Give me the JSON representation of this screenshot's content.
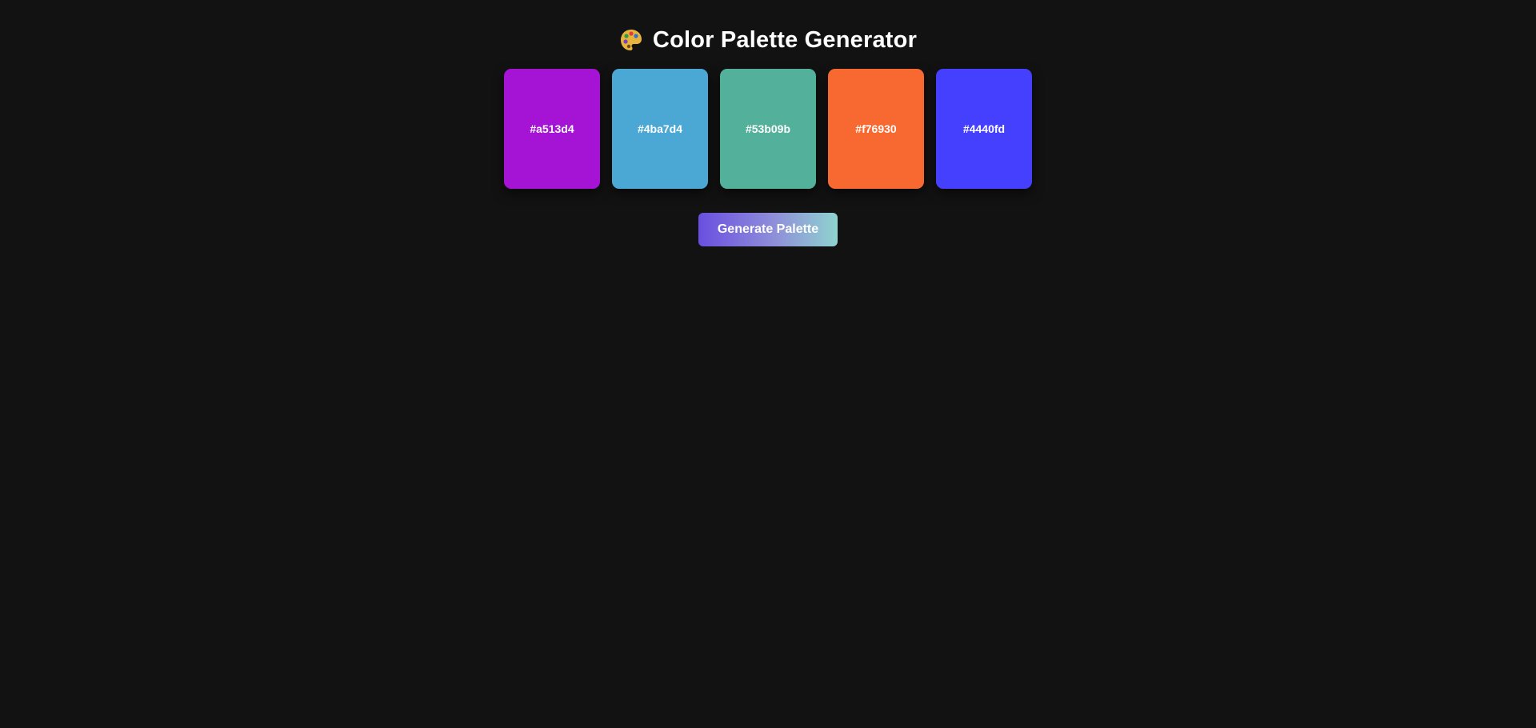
{
  "header": {
    "title": "Color Palette Generator",
    "icon": "palette-icon"
  },
  "palette": {
    "swatches": [
      {
        "hex": "#a513d4",
        "label": "#a513d4"
      },
      {
        "hex": "#4ba7d4",
        "label": "#4ba7d4"
      },
      {
        "hex": "#53b09b",
        "label": "#53b09b"
      },
      {
        "hex": "#f76930",
        "label": "#f76930"
      },
      {
        "hex": "#4440fd",
        "label": "#4440fd"
      }
    ]
  },
  "actions": {
    "generate_label": "Generate Palette"
  },
  "colors": {
    "background": "#121212",
    "text": "#ffffff",
    "button_gradient_start": "#6a4fe0",
    "button_gradient_end": "#8fd3cf"
  }
}
